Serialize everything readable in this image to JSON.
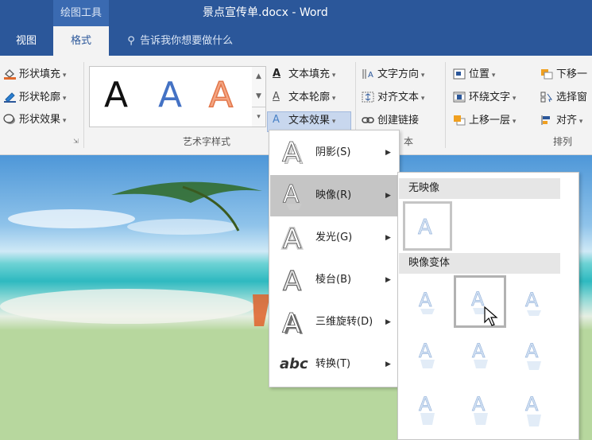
{
  "titlebar": {
    "context_tab": "绘图工具",
    "title": "景点宣传单.docx  -  Word"
  },
  "tabs": {
    "view": "视图",
    "format": "格式",
    "tell_me": "告诉我你想要做什么"
  },
  "ribbon": {
    "shape_fill": "形状填充",
    "shape_outline": "形状轮廓",
    "shape_effects": "形状效果",
    "gallery_letter": "A",
    "group_wordart": "艺术字样式",
    "text_fill": "文本填充",
    "text_outline": "文本轮廓",
    "text_effects": "文本效果",
    "text_direction": "文字方向",
    "align_text": "对齐文本",
    "create_link": "创建链接",
    "group_text_partial": "本",
    "position": "位置",
    "wrap_text": "环绕文字",
    "bring_forward": "上移一层",
    "send_backward": "下移一",
    "selection_pane": "选择窗",
    "align": "对齐",
    "group_arrange": "排列"
  },
  "menu": {
    "items": [
      {
        "label": "阴影(S)",
        "icon": "text-shadow-icon"
      },
      {
        "label": "映像(R)",
        "icon": "text-reflection-icon",
        "active": true
      },
      {
        "label": "发光(G)",
        "icon": "text-glow-icon"
      },
      {
        "label": "棱台(B)",
        "icon": "text-bevel-icon"
      },
      {
        "label": "三维旋转(D)",
        "icon": "text-3d-rotation-icon"
      },
      {
        "label": "转换(T)",
        "icon": "text-transform-icon",
        "glyph": "abc"
      }
    ]
  },
  "submenu": {
    "no_reflection_header": "无映像",
    "variations_header": "映像变体",
    "letter": "A"
  },
  "colors": {
    "accent": "#2b579a",
    "accent_light": "#3a6ab1",
    "doc_bg": "#b7d79e",
    "gallery_blue": "#4472c4",
    "gallery_orange": "#f4a582"
  }
}
